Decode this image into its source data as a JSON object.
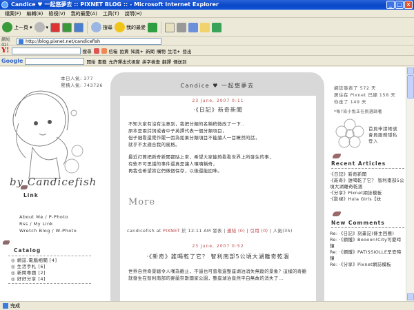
{
  "window": {
    "title": "Candice ♥ 一起悠夢去 :: PIXNET BLOG :: - Microsoft Internet Explorer"
  },
  "menu": [
    "檔案(F)",
    "編輯(E)",
    "檢視(V)",
    "我的最愛(A)",
    "工具(T)",
    "說明(H)"
  ],
  "toolbar": {
    "back": "上一頁",
    "search": "搜尋",
    "favorites": "我的最愛"
  },
  "address": {
    "label": "網址(D)",
    "url": "http://blog.pixnet.net/candicefish"
  },
  "yahoo": {
    "logo": "Y!",
    "search": "搜尋",
    "mail": "信箱",
    "auction": "拍賣",
    "knowledge": "知識+",
    "news": "新聞",
    "shopping": "購物",
    "life": "生活+",
    "logout": "登出"
  },
  "google": {
    "logo": "Google",
    "open": "開始",
    "bookmarks": "書籤",
    "popups": "允許彈出式視窗",
    "spell": "拼字檢查",
    "translate": "翻譯",
    "send": "傳送到"
  },
  "status": "完成",
  "left": {
    "stats": [
      "本日人氣: 377",
      "累積人氣: 743726"
    ],
    "signature": "by Candicefish",
    "link_head": "Link",
    "links": [
      "About Me / P-Photo",
      "Rss / My Link",
      "Wretch Blog / W-Photo"
    ],
    "catalog_head": "Catalog",
    "catalog": [
      "網誌.電腦相關 [4]",
      "生活手札 [6]",
      "新聞專題 [2]",
      "好好分享 [4]"
    ]
  },
  "center": {
    "blog_title": "Candice ♥ 一起悠夢去",
    "post1": {
      "date": "23 June, 2007 0:11",
      "title": "‧《日記》新奇新聞",
      "paragraphs": [
        "不知大家有沒有注意到，我把分類的名稱稍微改了一下..",
        "原本是兩詩詞或者中子英譯代表一個分類項目，",
        "但子細看還覺作罷一因為如果分類項目不能讓人一目瞭然的話，",
        "就乎不太適合我的風格。",
        "最近打算把新奇新聞都貼上來，希望大家能夠看看世界上所發生的事，",
        "有些不可思議的事件還真是讓人嘖嘖稱奇，",
        "再我也希望將它們做個保存，以後還能回味。"
      ],
      "more": "More",
      "meta_author": "candicefish at",
      "meta_site": "PIXNET",
      "meta_rest": "於 12:11 AM 發表 |",
      "meta_link": "連結 (0)",
      "meta_sep": " | ",
      "meta_ref": "引用 (0)",
      "meta_views": " | 人氣(35)"
    },
    "post2": {
      "date": "23 June, 2007 0:52",
      "title": "‧《新奇》誰喝乾了它？ 智利南部5公頃大湖離奇乾涸",
      "paragraph": "世界自然奇景總令人嘆為觀止，不過也可曾看過整座湖泊消失無蹤的景象？這樣的奇觀就發生在智利南部的麥蘭奈斯國家公園，整座湖泊竟然平白無故的消失了..."
    }
  },
  "right": {
    "stats": [
      "網誌發表了 572 天",
      "居住在 Pixnet 已經 158 天",
      "你走了 149 天"
    ],
    "note": "*每?染小兔正在挑選調著",
    "links": [
      "首頁申請帳號",
      "會員服務隱私",
      "登入"
    ],
    "recent_head": "Recent Articles",
    "recent": [
      "‧《日記》新奇新聞",
      "‧《新奇》誰喝乾了它？ 智利南部5公頃大湖離奇乾涸",
      "‧《分享》Pixnet網誌模板",
      "‧《影視》Hula Girls【扶"
    ],
    "comments_head": "New Comments",
    "comments": [
      "Re: ‧《日記》刻畫記(條主回應)",
      "Re: ‧《鋼鐵》Boooon!City可愛時鐘",
      "Re: ‧《鋼鐵》PATISSIOLLE早安時鐘",
      "Re: ‧《分享》Pixnet網誌模板"
    ]
  }
}
